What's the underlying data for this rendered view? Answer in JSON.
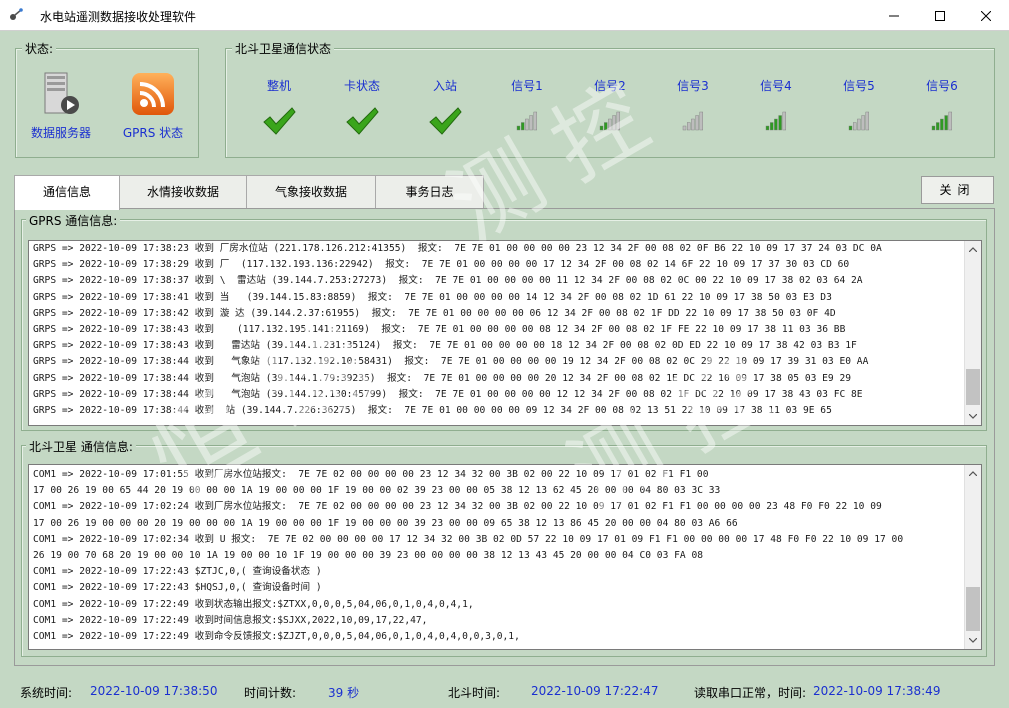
{
  "window": {
    "title": "水电站遥测数据接收处理软件",
    "minimize_icon": "minimize-icon",
    "maximize_icon": "maximize-icon",
    "close_icon": "close-icon"
  },
  "status_group": {
    "title": "状态:",
    "items": [
      {
        "label": "数据服务器",
        "icon": "server-icon"
      },
      {
        "label": "GPRS 状态",
        "icon": "rss-icon"
      }
    ]
  },
  "beidou_group": {
    "title": "北斗卫星通信状态",
    "columns": [
      {
        "label": "整机",
        "icon": "check-icon"
      },
      {
        "label": "卡状态",
        "icon": "check-icon"
      },
      {
        "label": "入站",
        "icon": "check-icon"
      },
      {
        "label": "信号1",
        "icon": "signal-icon",
        "level": 2
      },
      {
        "label": "信号2",
        "icon": "signal-icon",
        "level": 2
      },
      {
        "label": "信号3",
        "icon": "signal-icon",
        "level": 0
      },
      {
        "label": "信号4",
        "icon": "signal-icon",
        "level": 4
      },
      {
        "label": "信号5",
        "icon": "signal-icon",
        "level": 1
      },
      {
        "label": "信号6",
        "icon": "signal-icon",
        "level": 4
      }
    ]
  },
  "tabs": [
    {
      "label": "通信信息",
      "active": true
    },
    {
      "label": "水情接收数据",
      "active": false
    },
    {
      "label": "气象接收数据",
      "active": false
    },
    {
      "label": "事务日志",
      "active": false
    }
  ],
  "close_button": "关闭",
  "gprs_log": {
    "title": "GPRS 通信信息:",
    "lines": [
      "GRPS => 2022-10-09 17:38:23 收到 厂房水位站 (221.178.126.212:41355)  报文:  7E 7E 01 00 00 00 00 23 12 34 2F 00 08 02 0F B6 22 10 09 17 37 24 03 DC 0A",
      "GRPS => 2022-10-09 17:38:29 收到 厂  (117.132.193.136:22942)  报文:  7E 7E 01 00 00 00 00 17 12 34 2F 00 08 02 14 6F 22 10 09 17 37 30 03 CD 60",
      "GRPS => 2022-10-09 17:38:37 收到 \\  雷达站 (39.144.7.253:27273)  报文:  7E 7E 01 00 00 00 00 11 12 34 2F 00 08 02 0C 00 22 10 09 17 38 02 03 64 2A",
      "GRPS => 2022-10-09 17:38:41 收到 当   (39.144.15.83:8859)  报文:  7E 7E 01 00 00 00 00 14 12 34 2F 00 08 02 1D 61 22 10 09 17 38 50 03 E3 D3",
      "GRPS => 2022-10-09 17:38:42 收到 漩 达 (39.144.2.37:61955)  报文:  7E 7E 01 00 00 00 00 06 12 34 2F 00 08 02 1F DD 22 10 09 17 38 50 03 0F 4D",
      "GRPS => 2022-10-09 17:38:43 收到    (117.132.195.141:21169)  报文:  7E 7E 01 00 00 00 00 08 12 34 2F 00 08 02 1F FE 22 10 09 17 38 11 03 36 BB",
      "GRPS => 2022-10-09 17:38:43 收到   雷达站 (39.144.1.231:35124)  报文:  7E 7E 01 00 00 00 00 18 12 34 2F 00 08 02 0D ED 22 10 09 17 38 42 03 B3 1F",
      "GRPS => 2022-10-09 17:38:44 收到   气象站 (117.132.192.10:58431)  报文:  7E 7E 01 00 00 00 00 19 12 34 2F 00 08 02 0C 29 22 10 09 17 39 31 03 E0 AA",
      "GRPS => 2022-10-09 17:38:44 收到   气泡站 (39.144.1.79:39235)  报文:  7E 7E 01 00 00 00 00 20 12 34 2F 00 08 02 1E DC 22 10 09 17 38 05 03 E9 29",
      "GRPS => 2022-10-09 17:38:44 收到   气泡站 (39.144.12.130:45799)  报文:  7E 7E 01 00 00 00 00 12 12 34 2F 00 08 02 1F DC 22 10 09 17 38 43 03 FC 8E",
      "GRPS => 2022-10-09 17:38:44 收到  站 (39.144.7.226:36275)  报文:  7E 7E 01 00 00 00 00 09 12 34 2F 00 08 02 13 51 22 10 09 17 38 11 03 9E 65"
    ]
  },
  "beidou_log": {
    "title": "北斗卫星 通信信息:",
    "lines": [
      "COM1 => 2022-10-09 17:01:55 收到厂房水位站报文:  7E 7E 02 00 00 00 00 23 12 34 32 00 3B 02 00 22 10 09 17 01 02 F1 F1 00",
      "17 00 26 19 00 65 44 20 19 00 00 00 1A 19 00 00 00 1F 19 00 00 02 39 23 00 00 05 38 12 13 62 45 20 00 00 04 80 03 3C 33",
      "COM1 => 2022-10-09 17:02:24 收到厂房水位站报文:  7E 7E 02 00 00 00 00 23 12 34 32 00 3B 02 00 22 10 09 17 01 02 F1 F1 00 00 00 00 23 48 F0 F0 22 10 09",
      "17 00 26 19 00 00 00 20 19 00 00 00 1A 19 00 00 00 1F 19 00 00 00 39 23 00 00 09 65 38 12 13 86 45 20 00 00 04 80 03 A6 66",
      "COM1 => 2022-10-09 17:02:34 收到 U 报文:  7E 7E 02 00 00 00 00 17 12 34 32 00 3B 02 0D 57 22 10 09 17 01 09 F1 F1 00 00 00 00 17 48 F0 F0 22 10 09 17 00",
      "26 19 00 70 68 20 19 00 00 10 1A 19 00 00 10 1F 19 00 00 00 39 23 00 00 00 00 38 12 13 43 45 20 00 00 04 C0 03 FA 08",
      "COM1 => 2022-10-09 17:22:43 $ZTJC,0,( 查询设备状态 )",
      "COM1 => 2022-10-09 17:22:43 $HQSJ,0,( 查询设备时间 )",
      "COM1 => 2022-10-09 17:22:49 收到状态输出报文:$ZTXX,0,0,0,5,04,06,0,1,0,4,0,4,1,",
      "COM1 => 2022-10-09 17:22:49 收到时间信息报文:$SJXX,2022,10,09,17,22,47,",
      "COM1 => 2022-10-09 17:22:49 收到命令反馈报文:$ZJZT,0,0,0,5,04,06,0,1,0,4,0,4,0,0,3,0,1,"
    ]
  },
  "statusbar": {
    "system_time_label": "系统时间:",
    "system_time": "2022-10-09 17:38:50",
    "counter_label": "时间计数:",
    "counter_value": "39 秒",
    "beidou_time_label": "北斗时间:",
    "beidou_time": "2022-10-09 17:22:47",
    "serial_status": "读取串口正常，时间:",
    "serial_time": "2022-10-09 17:38:49"
  },
  "colors": {
    "background": "#c4d8c4",
    "label_blue": "#1a2fd0",
    "check_green": "#3aa51b",
    "rss_orange": "#f07a18"
  }
}
